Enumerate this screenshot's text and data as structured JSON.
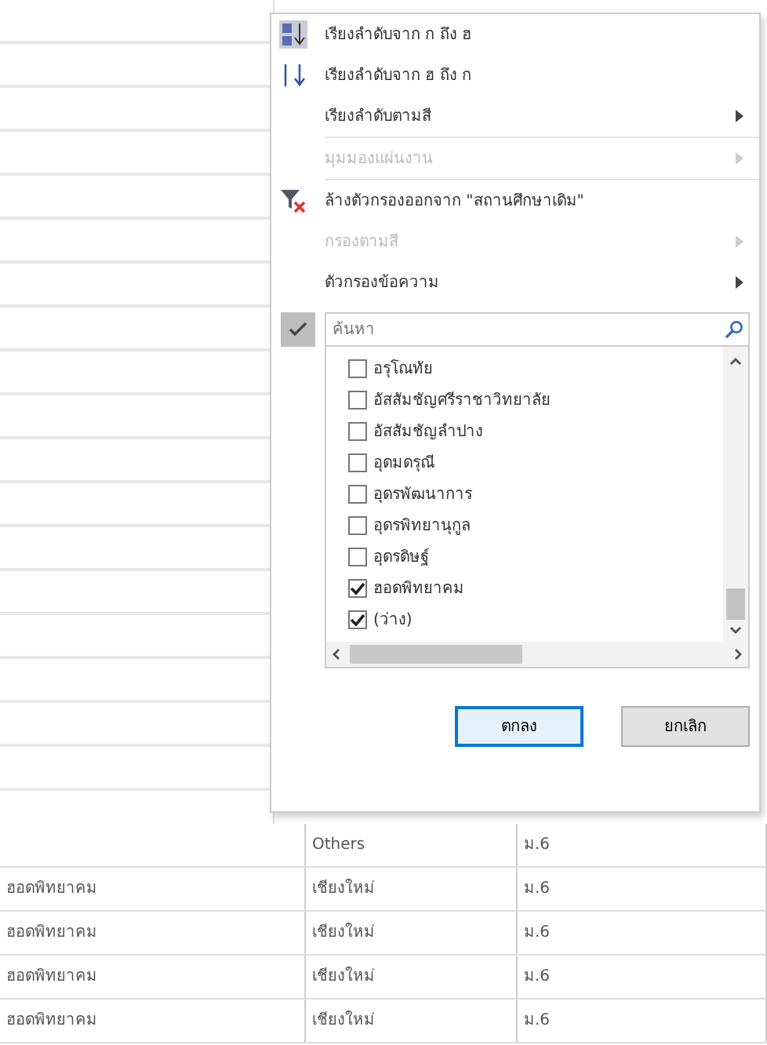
{
  "filter_menu": {
    "items": [
      {
        "label": "เรียงลำดับจาก ก ถึง ฮ",
        "disabled": false,
        "submenu": false
      },
      {
        "label": "เรียงลำดับจาก ฮ ถึง ก",
        "disabled": false,
        "submenu": false
      },
      {
        "label": "เรียงลำดับตามสี",
        "disabled": false,
        "submenu": true
      },
      {
        "label": "มุมมองแผ่นงาน",
        "disabled": true,
        "submenu": true
      },
      {
        "label": "ล้างตัวกรองออกจาก \"สถานศึกษาเดิม\"",
        "disabled": false,
        "submenu": false
      },
      {
        "label": "กรองตามสี",
        "disabled": true,
        "submenu": true
      },
      {
        "label": "ตัวกรองข้อความ",
        "disabled": false,
        "submenu": true
      }
    ],
    "text_filter_checked": true,
    "search": {
      "placeholder": "ค้นหา"
    },
    "values": [
      {
        "label": "อรุโณทัย",
        "checked": false
      },
      {
        "label": "อัสสัมชัญศรีราชาวิทยาลัย",
        "checked": false
      },
      {
        "label": "อัสสัมชัญลำปาง",
        "checked": false
      },
      {
        "label": "อุดมดรุณี",
        "checked": false
      },
      {
        "label": "อุดรพัฒนาการ",
        "checked": false
      },
      {
        "label": "อุดรพิทยานุกูล",
        "checked": false
      },
      {
        "label": "อุดรดิษฐ์",
        "checked": false
      },
      {
        "label": "ฮอดพิทยาคม",
        "checked": true
      },
      {
        "label": "(ว่าง)",
        "checked": true
      }
    ],
    "buttons": [
      {
        "label": "ตกลง",
        "primary": true
      },
      {
        "label": "ยกเลิก",
        "primary": false
      }
    ]
  },
  "table": {
    "rows": [
      [
        "",
        "Others",
        "ม.6"
      ],
      [
        "ฮอดพิทยาคม",
        "เชียงใหม่",
        "ม.6"
      ],
      [
        "ฮอดพิทยาคม",
        "เชียงใหม่",
        "ม.6"
      ],
      [
        "ฮอดพิทยาคม",
        "เชียงใหม่",
        "ม.6"
      ],
      [
        "ฮอดพิทยาคม",
        "เชียงใหม่",
        "ม.6"
      ]
    ]
  }
}
